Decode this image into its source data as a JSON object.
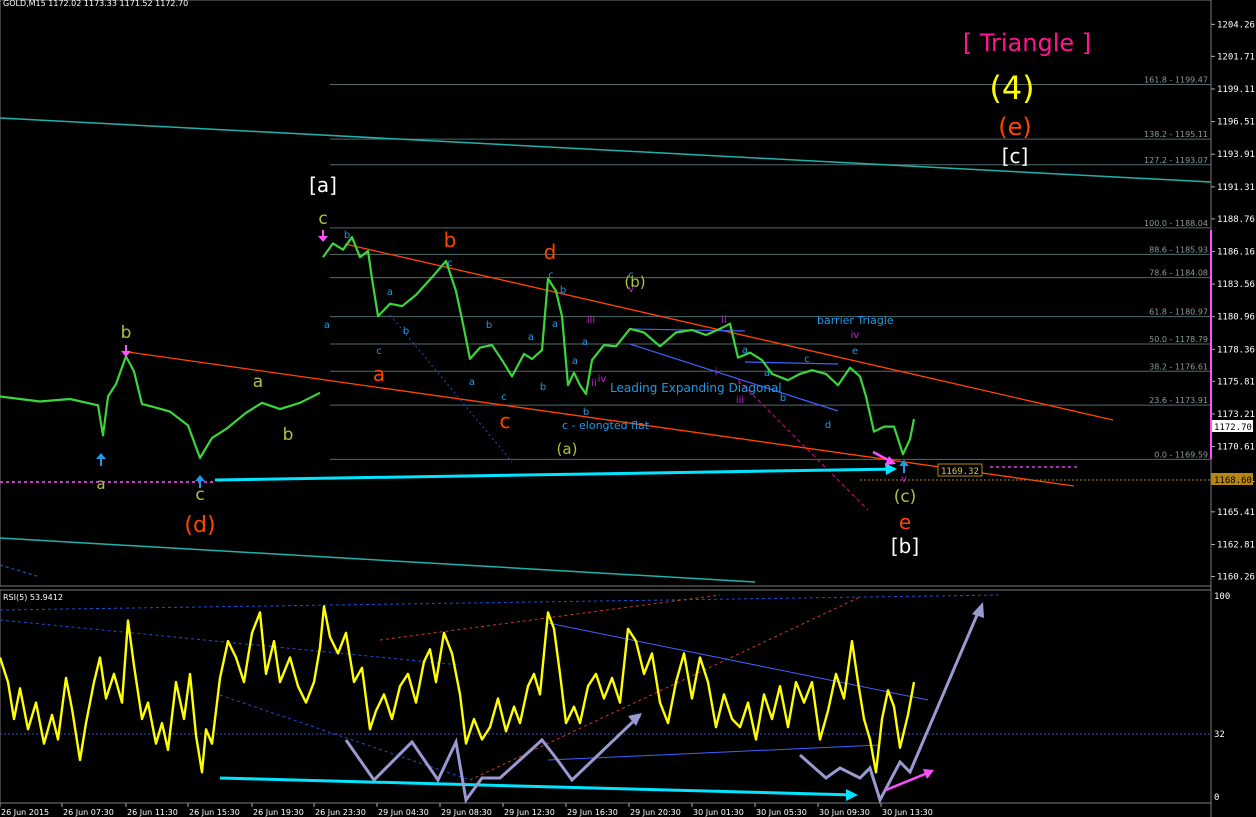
{
  "header": {
    "title": "GOLD,M15  1172.02 1173.33 1171.52 1172.70",
    "rsi_label": "RSI(5) 53.9412"
  },
  "chart_data": {
    "type": "line",
    "symbol": "GOLD",
    "timeframe": "M15",
    "ohlc": {
      "open": 1172.02,
      "high": 1173.33,
      "low": 1171.52,
      "close": 1172.7
    },
    "price_axis": {
      "ylim": [
        1159.5,
        1206.2
      ],
      "ticks": [
        1204.26,
        1201.71,
        1199.11,
        1196.51,
        1193.91,
        1191.31,
        1188.76,
        1186.16,
        1183.56,
        1180.96,
        1178.36,
        1175.81,
        1173.21,
        1170.61,
        1168.01,
        1165.41,
        1162.81,
        1160.26
      ],
      "current_price": "1172.70",
      "marker_price": "1168.60",
      "level_box": "1169.32"
    },
    "time_axis": {
      "ticks": [
        "26 Jun 2015",
        "26 Jun 07:30",
        "26 Jun 11:30",
        "26 Jun 15:30",
        "26 Jun 19:30",
        "26 Jun 23:30",
        "29 Jun 04:30",
        "29 Jun 08:30",
        "29 Jun 12:30",
        "29 Jun 16:30",
        "29 Jun 20:30",
        "30 Jun 01:30",
        "30 Jun 05:30",
        "30 Jun 09:30",
        "30 Jun 13:30"
      ]
    },
    "fibonacci": [
      {
        "label": "161.8 - 1199.47",
        "price": 1199.47
      },
      {
        "label": "138.2 - 1195.11",
        "price": 1195.11
      },
      {
        "label": "127.2 - 1193.07",
        "price": 1193.07
      },
      {
        "label": "100.0 - 1188.04",
        "price": 1188.04
      },
      {
        "label": "88.6 - 1185.93",
        "price": 1185.93
      },
      {
        "label": "78.6 - 1184.08",
        "price": 1184.08
      },
      {
        "label": "61.8 - 1180.97",
        "price": 1180.97
      },
      {
        "label": "50.0 - 1178.79",
        "price": 1178.79
      },
      {
        "label": "38.2 - 1176.61",
        "price": 1176.61
      },
      {
        "label": "23.6 - 1173.91",
        "price": 1173.91
      },
      {
        "label": "0.0 - 1169.59",
        "price": 1169.59
      }
    ],
    "price_series": [
      [
        0,
        1174.6
      ],
      [
        40,
        1174.2
      ],
      [
        70,
        1174.4
      ],
      [
        98,
        1173.9
      ],
      [
        103,
        1171.5
      ],
      [
        108,
        1174.6
      ],
      [
        116,
        1175.6
      ],
      [
        126,
        1177.8
      ],
      [
        134,
        1176.6
      ],
      [
        142,
        1174.0
      ],
      [
        152,
        1173.8
      ],
      [
        170,
        1173.4
      ],
      [
        188,
        1172.3
      ],
      [
        200,
        1169.7
      ],
      [
        212,
        1171.3
      ],
      [
        226,
        1172.0
      ],
      [
        246,
        1173.3
      ],
      [
        262,
        1174.1
      ],
      [
        280,
        1173.6
      ],
      [
        300,
        1174.1
      ],
      [
        320,
        1174.9
      ],
      [
        323,
        1185.7
      ],
      [
        333,
        1186.8
      ],
      [
        343,
        1186.3
      ],
      [
        352,
        1187.3
      ],
      [
        360,
        1185.7
      ],
      [
        368,
        1186.2
      ],
      [
        372,
        1184.0
      ],
      [
        378,
        1181.0
      ],
      [
        390,
        1182.0
      ],
      [
        402,
        1181.8
      ],
      [
        416,
        1182.7
      ],
      [
        432,
        1184.1
      ],
      [
        446,
        1185.4
      ],
      [
        456,
        1183.0
      ],
      [
        464,
        1180.0
      ],
      [
        470,
        1177.6
      ],
      [
        480,
        1178.5
      ],
      [
        492,
        1178.7
      ],
      [
        502,
        1177.5
      ],
      [
        512,
        1176.2
      ],
      [
        524,
        1178.0
      ],
      [
        532,
        1177.6
      ],
      [
        542,
        1178.3
      ],
      [
        548,
        1184.0
      ],
      [
        556,
        1183.0
      ],
      [
        562,
        1181.0
      ],
      [
        568,
        1175.5
      ],
      [
        574,
        1176.5
      ],
      [
        580,
        1175.5
      ],
      [
        586,
        1174.8
      ],
      [
        592,
        1177.5
      ],
      [
        604,
        1178.7
      ],
      [
        616,
        1178.6
      ],
      [
        630,
        1180.0
      ],
      [
        644,
        1179.7
      ],
      [
        660,
        1178.6
      ],
      [
        676,
        1179.7
      ],
      [
        692,
        1179.9
      ],
      [
        706,
        1179.5
      ],
      [
        720,
        1180.0
      ],
      [
        730,
        1180.4
      ],
      [
        738,
        1177.7
      ],
      [
        750,
        1178.1
      ],
      [
        762,
        1177.5
      ],
      [
        772,
        1176.4
      ],
      [
        788,
        1175.9
      ],
      [
        800,
        1176.4
      ],
      [
        812,
        1176.7
      ],
      [
        826,
        1176.4
      ],
      [
        838,
        1175.5
      ],
      [
        850,
        1176.9
      ],
      [
        860,
        1176.2
      ],
      [
        866,
        1174.6
      ],
      [
        874,
        1171.8
      ],
      [
        884,
        1172.2
      ],
      [
        894,
        1172.2
      ],
      [
        903,
        1170.0
      ],
      [
        910,
        1171.2
      ],
      [
        914,
        1172.8
      ]
    ],
    "rsi": {
      "name": "RSI(5)",
      "value": 53.9412,
      "ylim": [
        0,
        100
      ],
      "levels": [
        32
      ],
      "tick_labels": [
        "100",
        "32",
        "0"
      ],
      "series": [
        [
          0,
          70
        ],
        [
          8,
          58
        ],
        [
          14,
          40
        ],
        [
          20,
          55
        ],
        [
          28,
          35
        ],
        [
          36,
          48
        ],
        [
          44,
          28
        ],
        [
          52,
          42
        ],
        [
          58,
          30
        ],
        [
          66,
          60
        ],
        [
          72,
          45
        ],
        [
          80,
          20
        ],
        [
          86,
          38
        ],
        [
          94,
          58
        ],
        [
          100,
          70
        ],
        [
          106,
          50
        ],
        [
          114,
          62
        ],
        [
          122,
          48
        ],
        [
          128,
          88
        ],
        [
          134,
          66
        ],
        [
          142,
          40
        ],
        [
          148,
          48
        ],
        [
          156,
          28
        ],
        [
          162,
          38
        ],
        [
          168,
          25
        ],
        [
          176,
          58
        ],
        [
          184,
          40
        ],
        [
          190,
          62
        ],
        [
          196,
          32
        ],
        [
          202,
          14
        ],
        [
          206,
          35
        ],
        [
          212,
          28
        ],
        [
          220,
          60
        ],
        [
          228,
          78
        ],
        [
          236,
          70
        ],
        [
          244,
          58
        ],
        [
          252,
          82
        ],
        [
          260,
          92
        ],
        [
          266,
          62
        ],
        [
          274,
          78
        ],
        [
          280,
          58
        ],
        [
          290,
          70
        ],
        [
          298,
          56
        ],
        [
          306,
          48
        ],
        [
          314,
          58
        ],
        [
          320,
          75
        ],
        [
          324,
          95
        ],
        [
          330,
          80
        ],
        [
          338,
          72
        ],
        [
          346,
          82
        ],
        [
          354,
          58
        ],
        [
          362,
          65
        ],
        [
          370,
          35
        ],
        [
          376,
          44
        ],
        [
          384,
          52
        ],
        [
          392,
          40
        ],
        [
          400,
          56
        ],
        [
          408,
          62
        ],
        [
          416,
          48
        ],
        [
          424,
          68
        ],
        [
          430,
          74
        ],
        [
          436,
          58
        ],
        [
          444,
          82
        ],
        [
          452,
          72
        ],
        [
          460,
          52
        ],
        [
          466,
          28
        ],
        [
          474,
          40
        ],
        [
          482,
          30
        ],
        [
          490,
          36
        ],
        [
          498,
          50
        ],
        [
          506,
          34
        ],
        [
          514,
          46
        ],
        [
          520,
          38
        ],
        [
          528,
          56
        ],
        [
          534,
          62
        ],
        [
          540,
          52
        ],
        [
          548,
          92
        ],
        [
          554,
          84
        ],
        [
          560,
          62
        ],
        [
          566,
          38
        ],
        [
          574,
          46
        ],
        [
          580,
          38
        ],
        [
          588,
          56
        ],
        [
          596,
          62
        ],
        [
          604,
          50
        ],
        [
          612,
          60
        ],
        [
          620,
          48
        ],
        [
          628,
          84
        ],
        [
          636,
          78
        ],
        [
          644,
          62
        ],
        [
          652,
          72
        ],
        [
          660,
          48
        ],
        [
          668,
          38
        ],
        [
          676,
          58
        ],
        [
          684,
          72
        ],
        [
          692,
          50
        ],
        [
          700,
          70
        ],
        [
          708,
          58
        ],
        [
          716,
          36
        ],
        [
          724,
          52
        ],
        [
          732,
          40
        ],
        [
          740,
          36
        ],
        [
          748,
          48
        ],
        [
          756,
          30
        ],
        [
          764,
          52
        ],
        [
          772,
          40
        ],
        [
          780,
          56
        ],
        [
          788,
          36
        ],
        [
          796,
          58
        ],
        [
          804,
          48
        ],
        [
          812,
          58
        ],
        [
          820,
          30
        ],
        [
          828,
          44
        ],
        [
          836,
          62
        ],
        [
          844,
          50
        ],
        [
          852,
          78
        ],
        [
          858,
          58
        ],
        [
          864,
          40
        ],
        [
          870,
          30
        ],
        [
          876,
          14
        ],
        [
          882,
          40
        ],
        [
          888,
          54
        ],
        [
          894,
          46
        ],
        [
          900,
          26
        ],
        [
          908,
          42
        ],
        [
          914,
          58
        ]
      ]
    }
  },
  "annotations": {
    "triangle": "[ Triangle ]",
    "wave4": "(4)",
    "wave_e_paren": "(e)",
    "c_bracket": "[c]",
    "a_bracket": "[a]",
    "b_bracket": "[b]",
    "d_paren": "(d)",
    "c_paren": "(c)",
    "a_paren": "(a)",
    "b_paren": "(b)",
    "elongated_flat": "c - elongted flat",
    "leading_diagonal": "Leading Expanding Diagonal",
    "barrier": "barrier Triagle",
    "lbl_a": "a",
    "lbl_b": "b",
    "lbl_c": "c",
    "lbl_d": "d",
    "lbl_e": "e",
    "lbl_i": "i",
    "lbl_ii": "ii",
    "lbl_iii": "iii",
    "lbl_iv": "iv",
    "lbl_v": "v"
  },
  "colors": {
    "background": "#000000",
    "price": "#3cd53c",
    "rsi": "#ffff00",
    "fib": "#4f6b6b",
    "trend_red": "#ff4500",
    "teal": "#20b2aa",
    "cyan_arrow": "#00e5ff",
    "magenta": "#ff00ff",
    "blue_wave": "#1e9be8",
    "lavender": "#9a9ad2",
    "green_label": "#adc33a"
  }
}
